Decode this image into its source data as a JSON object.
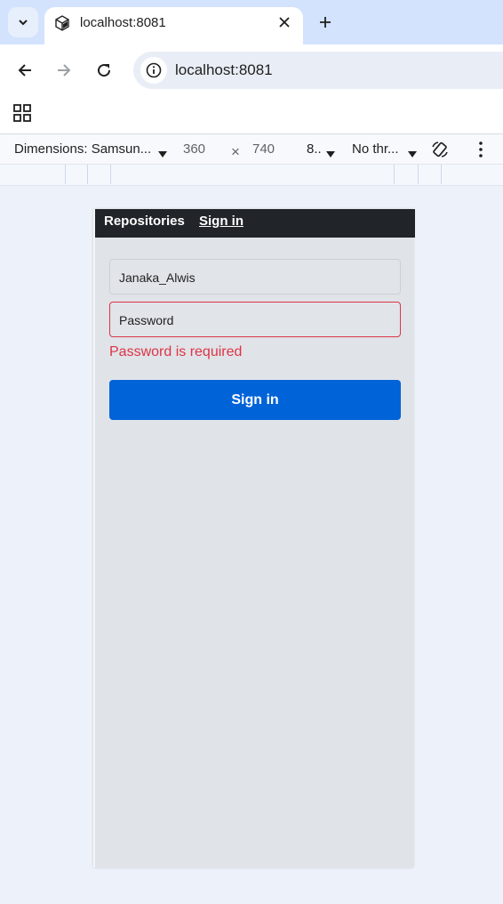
{
  "browser": {
    "tab_title": "localhost:8081",
    "url": "localhost:8081"
  },
  "devtools": {
    "dimensions_label": "Dimensions: Samsun...",
    "width": "360",
    "times": "×",
    "height": "740",
    "zoom": "8..",
    "throttle": "No thr..."
  },
  "app": {
    "brand": "Repositories",
    "nav_signin": "Sign in",
    "username_value": "Janaka_Alwis",
    "password_placeholder": "Password",
    "error": "Password is required",
    "submit_label": "Sign in"
  },
  "colors": {
    "navbar": "#212529",
    "primary": "#0063d8",
    "danger": "#dc3545"
  }
}
